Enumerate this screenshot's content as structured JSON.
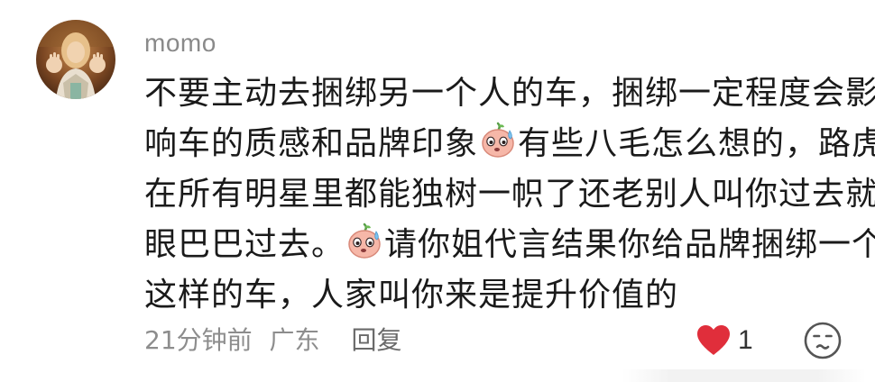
{
  "comment": {
    "username": "momo",
    "lines": [
      "不要主动去捆绑另一个人的车，捆绑一定程度会影",
      [
        "响车的质感和品牌印象",
        "有些八毛怎么想的，路虎"
      ],
      "在所有明星里都能独树一帜了还老别人叫你过去就",
      [
        "眼巴巴过去。",
        "请你姐代言结果你给品牌捆绑一个"
      ],
      "这样的车，人家叫你来是提升价值的"
    ],
    "emoji_name": "sweat-smile-emoji",
    "time": "21分钟前",
    "location": "广东",
    "reply_label": "回复",
    "like_count": "1",
    "colors": {
      "like": "#e02e3b",
      "meta": "#8d8d8d",
      "text": "#1a1a1a"
    }
  }
}
